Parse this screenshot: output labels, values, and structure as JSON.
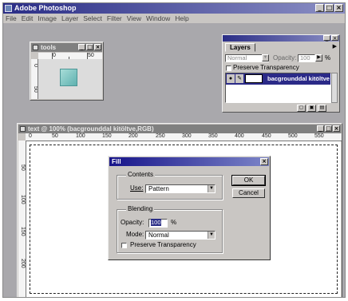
{
  "app": {
    "title": "Adobe Photoshop"
  },
  "menu": [
    "File",
    "Edit",
    "Image",
    "Layer",
    "Select",
    "Filter",
    "View",
    "Window",
    "Help"
  ],
  "small_doc": {
    "title": "tools",
    "ruler_h": [
      "0",
      "50"
    ],
    "ruler_v": [
      "0",
      "50"
    ]
  },
  "layers": {
    "tab": "Layers",
    "mode": "Normal",
    "opacity_label": "Opacity:",
    "opacity_value": "100",
    "opacity_unit": "%",
    "preserve_label": "Preserve Transparency",
    "layer_name": "bacgrounddal kitöltve"
  },
  "main_doc": {
    "title": "text @ 100% (bacgrounddal kitöltve,RGB)",
    "ruler_h": [
      "0",
      "50",
      "100",
      "150",
      "200",
      "250",
      "300",
      "350",
      "400",
      "450",
      "500",
      "550"
    ],
    "ruler_v": [
      "50",
      "100",
      "150",
      "200"
    ]
  },
  "fill_dialog": {
    "title": "Fill",
    "contents_label": "Contents",
    "use_label": "Use:",
    "use_value": "Pattern",
    "ok": "OK",
    "cancel": "Cancel",
    "blending_label": "Blending",
    "opacity_label": "Opacity:",
    "opacity_value": "100",
    "opacity_unit": "%",
    "mode_label": "Mode:",
    "mode_value": "Normal",
    "preserve_label": "Preserve Transparency",
    "close": "×"
  },
  "window_buttons": {
    "minimize": "_",
    "maximize": "□",
    "close": "×"
  }
}
